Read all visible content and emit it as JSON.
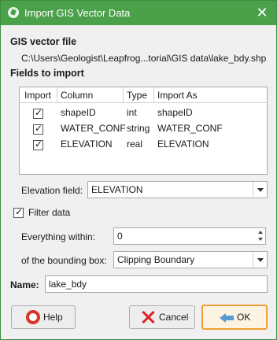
{
  "window": {
    "title": "Import GIS Vector Data"
  },
  "vector_file": {
    "section_title": "GIS vector file",
    "path": "C:\\Users\\Geologist\\Leapfrog...torial\\GIS data\\lake_bdy.shp"
  },
  "fields": {
    "section_title": "Fields to import",
    "headers": {
      "import": "Import",
      "column": "Column",
      "type": "Type",
      "import_as": "Import As"
    },
    "rows": [
      {
        "checked": true,
        "column": "shapeID",
        "type": "int",
        "import_as": "shapeID"
      },
      {
        "checked": true,
        "column": "WATER_CONF",
        "type": "string",
        "import_as": "WATER_CONF"
      },
      {
        "checked": true,
        "column": "ELEVATION",
        "type": "real",
        "import_as": "ELEVATION"
      }
    ]
  },
  "elevation": {
    "label": "Elevation field:",
    "value": "ELEVATION"
  },
  "filter": {
    "checked": true,
    "label": "Filter data",
    "within_label": "Everything within:",
    "within_value": "0",
    "bbox_label": "of the bounding box:",
    "bbox_value": "Clipping Boundary"
  },
  "name": {
    "label": "Name:",
    "value": "lake_bdy"
  },
  "buttons": {
    "help": "Help",
    "cancel": "Cancel",
    "ok": "OK"
  },
  "colors": {
    "titlebar": "#4aa14a",
    "ok_border": "#f0a030"
  }
}
